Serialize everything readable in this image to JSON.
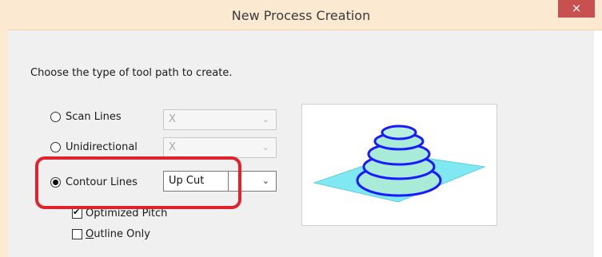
{
  "window": {
    "title": "New Process Creation",
    "close_glyph": "×"
  },
  "prompt": "Choose the type of tool path to create.",
  "options": [
    {
      "label": "Scan Lines",
      "selected": false,
      "combo_value": "X",
      "combo_enabled": false
    },
    {
      "label": "Unidirectional",
      "selected": false,
      "combo_value": "X",
      "combo_enabled": false
    },
    {
      "label": "Contour Lines",
      "selected": true,
      "combo_value": "Up Cut",
      "combo_enabled": true
    }
  ],
  "checkboxes": [
    {
      "label": "Optimized Pitch",
      "checked": true
    },
    {
      "label": "Outline Only",
      "accel": "O",
      "rest": "utline Only",
      "checked": false
    }
  ],
  "colors": {
    "title_bar": "#fbe9d2",
    "close": "#c75050",
    "highlight": "#e0222a",
    "plane": "#7fe8f0",
    "contour": "#1a1aff"
  },
  "preview": {
    "icon": "contour-lines-toolpath-preview"
  }
}
